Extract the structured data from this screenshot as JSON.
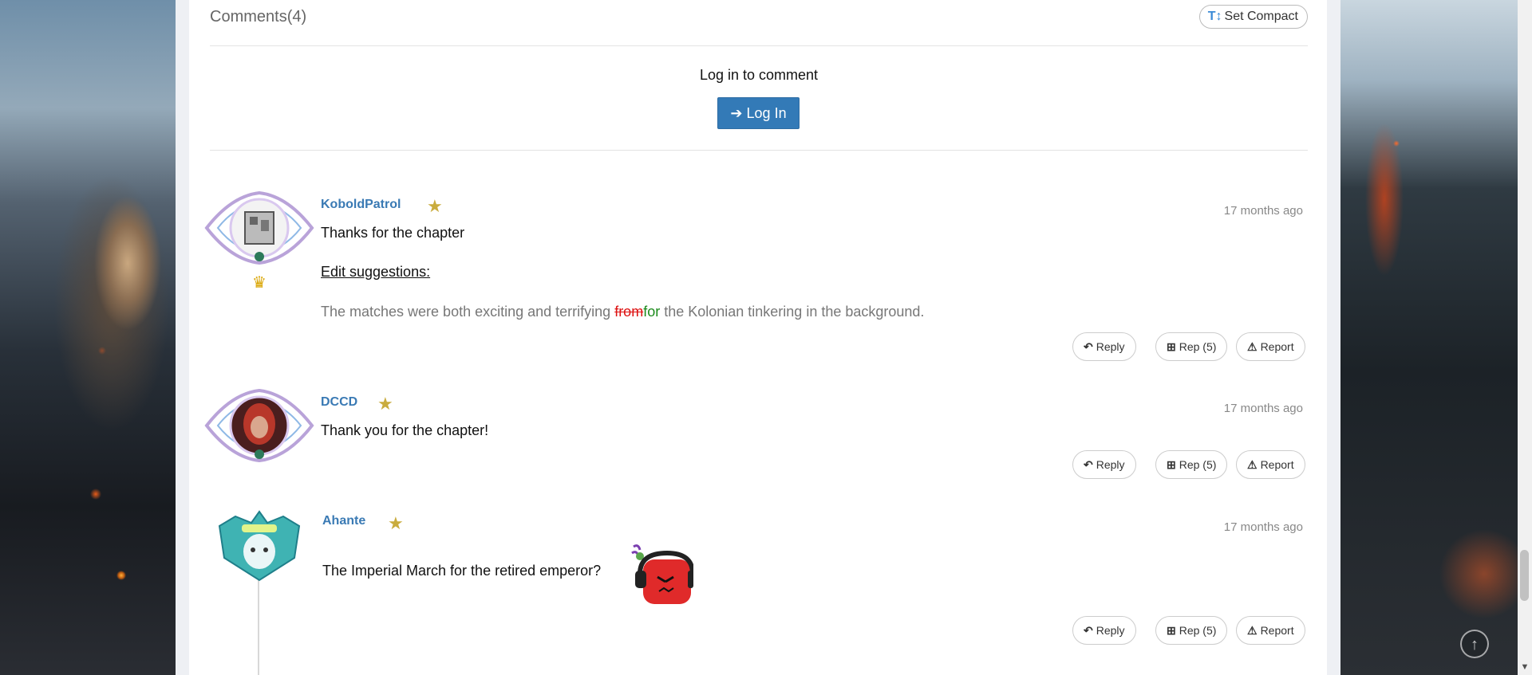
{
  "comments_header": {
    "title": "Comments(4)",
    "compact_label": "Set Compact"
  },
  "login": {
    "prompt": "Log in to comment",
    "button_label": "Log In"
  },
  "comments": [
    {
      "username": "KoboldPatrol",
      "time": "17 months ago",
      "line1": "Thanks for the chapter",
      "edit_heading": "Edit suggestions:",
      "sug_before": "The matches were both exciting and terrifying ",
      "sug_deleted": "from",
      "sug_inserted": "for",
      "sug_after": " the Kolonian tinkering in the background.",
      "reply": "Reply",
      "rep": "Rep (5)",
      "report": "Report"
    },
    {
      "username": "DCCD",
      "time": "17 months ago",
      "line1": "Thank you for the chapter!",
      "reply": "Reply",
      "rep": "Rep (5)",
      "report": "Report"
    },
    {
      "username": "Ahante",
      "time": "17 months ago",
      "line1": "The Imperial March for the retired emperor?",
      "reply": "Reply",
      "rep": "Rep (5)",
      "report": "Report"
    }
  ],
  "colors": {
    "link": "#3a7ab4",
    "login_button": "#337ab7",
    "star": "#c9ac3e",
    "deleted": "#dd1111",
    "inserted": "#1a8a1a"
  }
}
